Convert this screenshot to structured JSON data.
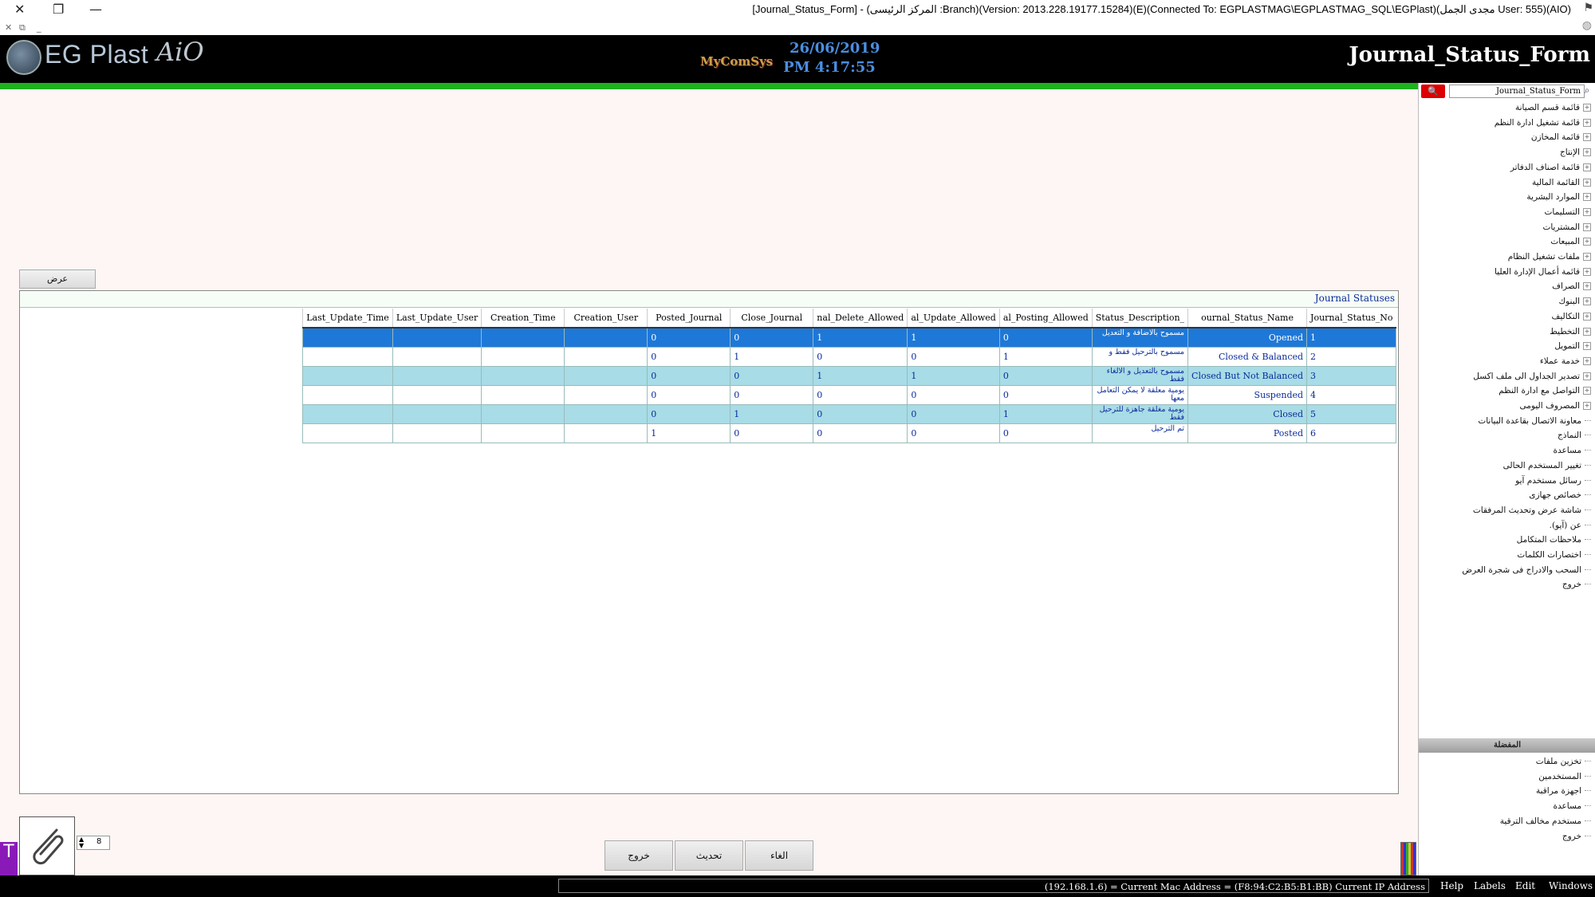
{
  "window": {
    "title": "[Journal_Status_Form] - (المركز الرئيسى :Branch)(Version: 2013.228.19177.15284)(E)(Connected To: EGPLASTMAG\\EGPLASTMAG_SQL\\EGPlast)(مجدى الجمل User: 555)(AIO)",
    "close_glyph": "✕",
    "restore_glyph": "❐",
    "minimize_glyph": "—",
    "mini_close": "✕",
    "mini_restore": "⧉",
    "mini_min": "_"
  },
  "header": {
    "logo_text": "EG Plast",
    "logo_suffix": "AiO",
    "brand": "MyComSys",
    "date": "26/06/2019",
    "time": "PM 4:17:55",
    "form_title": "Journal_Status_Form"
  },
  "sidebar": {
    "search_value": "Journal_Status_Form",
    "search_button_icon": "search-icon",
    "tree": [
      {
        "label": "قائمة قسم الصيانة",
        "expandable": true
      },
      {
        "label": "قائمة تشغيل ادارة النظم",
        "expandable": true
      },
      {
        "label": "قائمة المخازن",
        "expandable": true
      },
      {
        "label": "الإنتاج",
        "expandable": true
      },
      {
        "label": "قائمة اصناف الدفاتر",
        "expandable": true
      },
      {
        "label": "القائمة المالية",
        "expandable": true
      },
      {
        "label": "الموارد البشرية",
        "expandable": true
      },
      {
        "label": "التسليمات",
        "expandable": true
      },
      {
        "label": "المشتريات",
        "expandable": true
      },
      {
        "label": "المبيعات",
        "expandable": true
      },
      {
        "label": "ملفات تشغيل النظام",
        "expandable": true
      },
      {
        "label": "قائمة أعمال الإدارة العليا",
        "expandable": true
      },
      {
        "label": "الصراف",
        "expandable": true
      },
      {
        "label": "البنوك",
        "expandable": true
      },
      {
        "label": "التكاليف",
        "expandable": true
      },
      {
        "label": "التخطيط",
        "expandable": true
      },
      {
        "label": "التمويل",
        "expandable": true
      },
      {
        "label": "خدمة عملاء",
        "expandable": true
      },
      {
        "label": "تصدير الجداول الى ملف اكسل",
        "expandable": true
      },
      {
        "label": "التواصل مع ادارة النظم",
        "expandable": true
      },
      {
        "label": "المصروف اليومى",
        "expandable": true
      },
      {
        "label": "معاونة الاتصال بقاعدة البيانات",
        "expandable": false
      },
      {
        "label": "النماذج",
        "expandable": false
      },
      {
        "label": "مساعدة",
        "expandable": false
      },
      {
        "label": "تغيير المستخدم الحالى",
        "expandable": false
      },
      {
        "label": "رسائل مستخدم آيو",
        "expandable": false
      },
      {
        "label": "خصائص جهازى",
        "expandable": false
      },
      {
        "label": "شاشة عرض وتحديث المرفقات",
        "expandable": false
      },
      {
        "label": "عن (آيو).",
        "expandable": false
      },
      {
        "label": "ملاحظات المتكامل",
        "expandable": false
      },
      {
        "label": "اختصارات الكلمات",
        "expandable": false
      },
      {
        "label": "السحب والادراج فى شجرة العرض",
        "expandable": false
      },
      {
        "label": "خروج",
        "expandable": false
      }
    ],
    "lower_title": "المفضلة",
    "lower_items": [
      {
        "label": "تخزين ملفات"
      },
      {
        "label": "المستخدمين"
      },
      {
        "label": "اجهزة مراقبة"
      },
      {
        "label": "مساعدة"
      },
      {
        "label": "مستخدم مخالف الترقية"
      },
      {
        "label": "خروج"
      }
    ]
  },
  "main": {
    "view_button": "عرض",
    "grid_caption": "Journal Statuses",
    "columns": [
      "Journal_Status_No",
      "ournal_Status_Name",
      "_Status_Description",
      "al_Posting_Allowed",
      "al_Update_Allowed",
      "nal_Delete_Allowed",
      "Close_Journal",
      "Posted_Journal",
      "Creation_User",
      "Creation_Time",
      "Last_Update_User",
      "Last_Update_Time"
    ],
    "rows": [
      {
        "no": "1",
        "name": "Opened",
        "desc": "مسموح بالاضافة و التعديل",
        "posting": "0",
        "update": "1",
        "delete": "1",
        "close": "0",
        "posted": "0",
        "cuser": "",
        "ctime": "",
        "luser": "",
        "ltime": ""
      },
      {
        "no": "2",
        "name": "Closed & Balanced",
        "desc": "مسموح بالترحيل فقط و",
        "posting": "1",
        "update": "0",
        "delete": "0",
        "close": "1",
        "posted": "0",
        "cuser": "",
        "ctime": "",
        "luser": "",
        "ltime": ""
      },
      {
        "no": "3",
        "name": "Closed But Not Balanced",
        "desc": "مسموح بالتعديل و الالغاء فقط",
        "posting": "0",
        "update": "1",
        "delete": "1",
        "close": "0",
        "posted": "0",
        "cuser": "",
        "ctime": "",
        "luser": "",
        "ltime": ""
      },
      {
        "no": "4",
        "name": "Suspended",
        "desc": "يومية معلقة لا يمكن التعامل معها",
        "posting": "0",
        "update": "0",
        "delete": "0",
        "close": "0",
        "posted": "0",
        "cuser": "",
        "ctime": "",
        "luser": "",
        "ltime": ""
      },
      {
        "no": "5",
        "name": "Closed",
        "desc": "يومية مغلقة جاهزة للترحيل فقط",
        "posting": "1",
        "update": "0",
        "delete": "0",
        "close": "1",
        "posted": "0",
        "cuser": "",
        "ctime": "",
        "luser": "",
        "ltime": ""
      },
      {
        "no": "6",
        "name": "Posted",
        "desc": "تم الترحيل",
        "posting": "0",
        "update": "0",
        "delete": "0",
        "close": "0",
        "posted": "1",
        "cuser": "",
        "ctime": "",
        "luser": "",
        "ltime": ""
      }
    ]
  },
  "bottom": {
    "spinner_value": "8",
    "exit_button": "خروج",
    "refresh_button": "تحديث",
    "cancel_button": "الغاء",
    "side_mark": "T"
  },
  "statusbar": {
    "info": "(192.168.1.6) = Current Mac Address = (F8:94:C2:B5:B1:BB) Current IP Address",
    "menus": [
      "Help",
      "Labels",
      "Edit",
      "Windows"
    ]
  }
}
